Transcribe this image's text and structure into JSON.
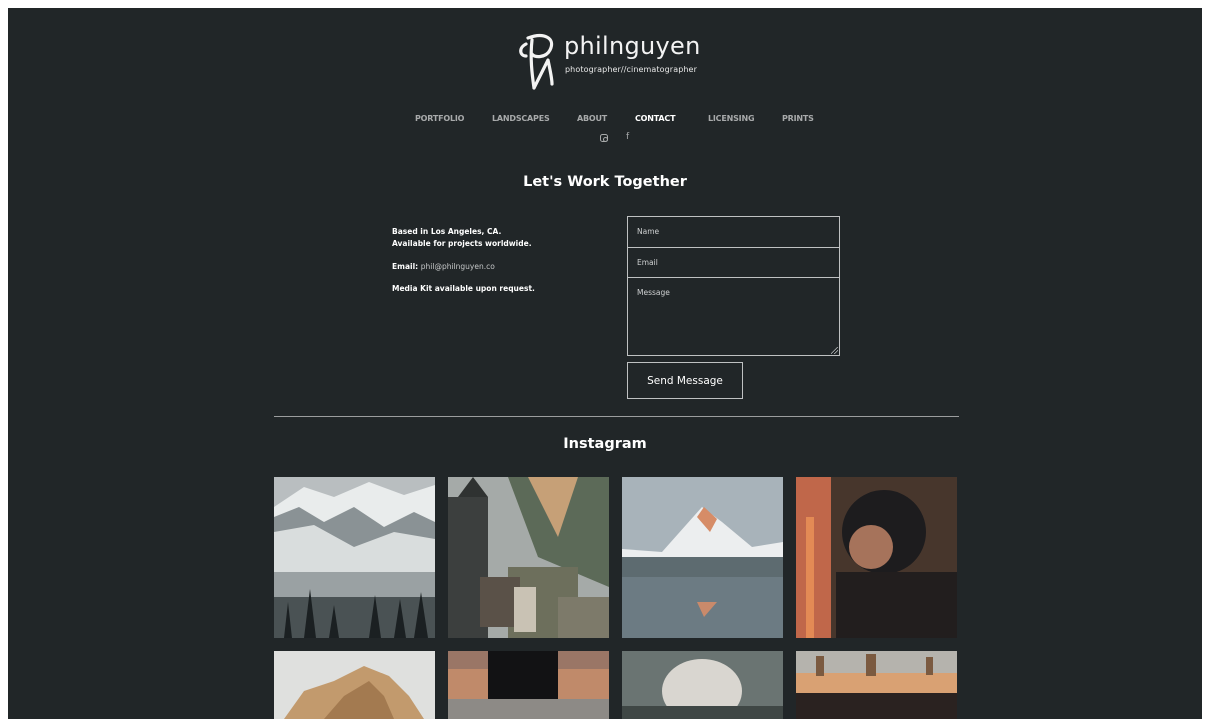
{
  "brand": {
    "name": "philnguyen",
    "tagline": "photographer//cinematographer"
  },
  "nav": {
    "items": [
      {
        "label": "PORTFOLIO"
      },
      {
        "label": "LANDSCAPES"
      },
      {
        "label": "ABOUT"
      },
      {
        "label": "CONTACT"
      },
      {
        "label": "LICENSING"
      },
      {
        "label": "PRINTS"
      }
    ],
    "active": "CONTACT"
  },
  "social": {
    "icons": [
      "instagram-icon",
      "facebook-icon"
    ],
    "facebook_glyph": "f"
  },
  "contact": {
    "heading": "Let's Work Together",
    "info_line1": "Based in Los Angeles, CA.",
    "info_line2": "Available for projects worldwide.",
    "email_label": "Email:",
    "email_value": "phil@philnguyen.co",
    "media_kit": "Media Kit available upon request.",
    "form": {
      "name_placeholder": "Name",
      "email_placeholder": "Email",
      "message_placeholder": "Message",
      "submit_label": "Send Message"
    }
  },
  "instagram": {
    "heading": "Instagram",
    "photos": [
      {
        "subject": "snowy mountain lake with pines"
      },
      {
        "subject": "cabin with wooden hot tub in valley"
      },
      {
        "subject": "matterhorn reflection at sunrise"
      },
      {
        "subject": "portrait with motorcycle helmet"
      },
      {
        "subject": "desert rock formation"
      },
      {
        "subject": "photographer with camera at sunset"
      },
      {
        "subject": "geyser steam over water"
      },
      {
        "subject": "desert rock spires"
      }
    ]
  },
  "colors": {
    "background": "#212628",
    "text": "#ffffff",
    "muted_text": "#a8aaab",
    "border": "#bfc1c2"
  }
}
